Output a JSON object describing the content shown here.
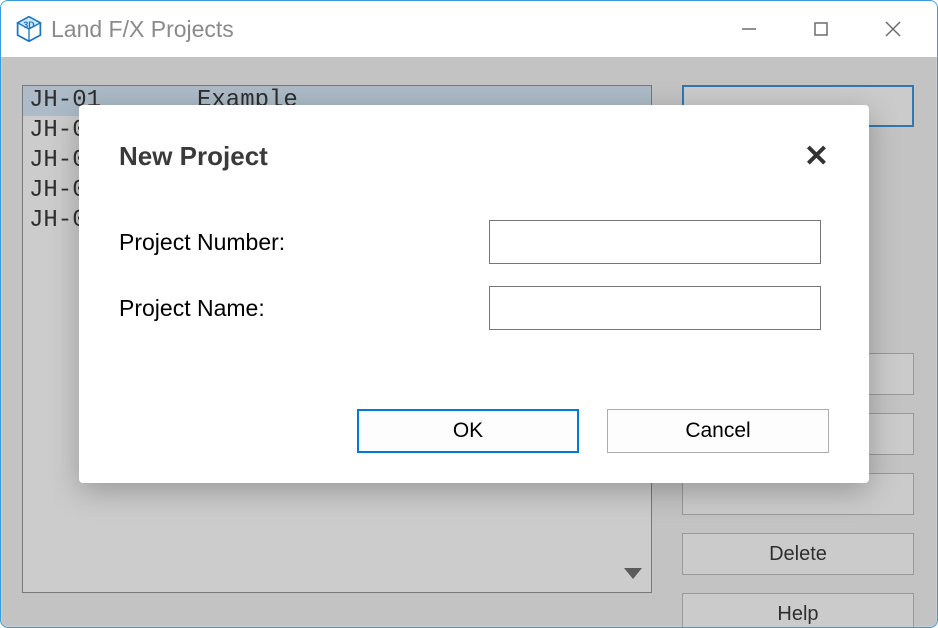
{
  "window": {
    "title": "Land F/X Projects"
  },
  "projects": [
    {
      "num": "JH-01",
      "name": "Example"
    },
    {
      "num": "JH-0",
      "name": ""
    },
    {
      "num": "JH-0",
      "name": ""
    },
    {
      "num": "JH-0",
      "name": ""
    },
    {
      "num": "JH-0",
      "name": ""
    }
  ],
  "sidebar": {
    "buttons": [
      "",
      "",
      "",
      "",
      "",
      "",
      "",
      "Delete",
      "Help"
    ]
  },
  "modal": {
    "title": "New Project",
    "fields": {
      "number_label": "Project Number:",
      "number_value": "",
      "name_label": "Project Name:",
      "name_value": ""
    },
    "ok_label": "OK",
    "cancel_label": "Cancel"
  }
}
